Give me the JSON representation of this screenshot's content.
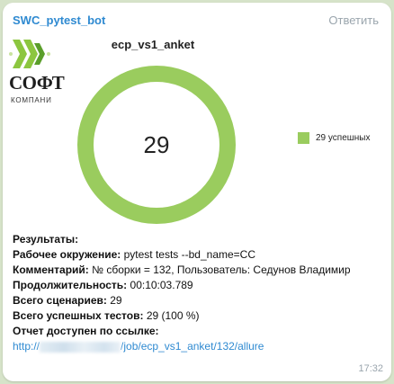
{
  "message": {
    "sender": "SWC_pytest_bot",
    "reply_label": "Ответить",
    "time": "17:32"
  },
  "logo": {
    "text": "СОФТ",
    "sub": "КОМПАНИ"
  },
  "chart_data": {
    "type": "pie",
    "title": "ecp_vs1_anket",
    "center_label": "29",
    "series": [
      {
        "name": "29 успешных",
        "value": 29,
        "color": "#9acc5e"
      }
    ]
  },
  "results": {
    "heading": "Результаты:",
    "env_label": "Рабочее окружение:",
    "env_value": " pytest tests --bd_name=CC",
    "comment_label": "Комментарий:",
    "comment_value": " № сборки = 132, Пользователь: Седунов Владимир",
    "duration_label": "Продолжительность:",
    "duration_value": " 00:10:03.789",
    "scenarios_label": "Всего сценариев:",
    "scenarios_value": " 29",
    "passed_label": "Всего успешных тестов:",
    "passed_value": " 29 (100 %)",
    "report_label": "Отчет доступен по ссылке:",
    "link_prefix": "http://",
    "link_suffix": "/job/ecp_vs1_anket/132/allure"
  }
}
